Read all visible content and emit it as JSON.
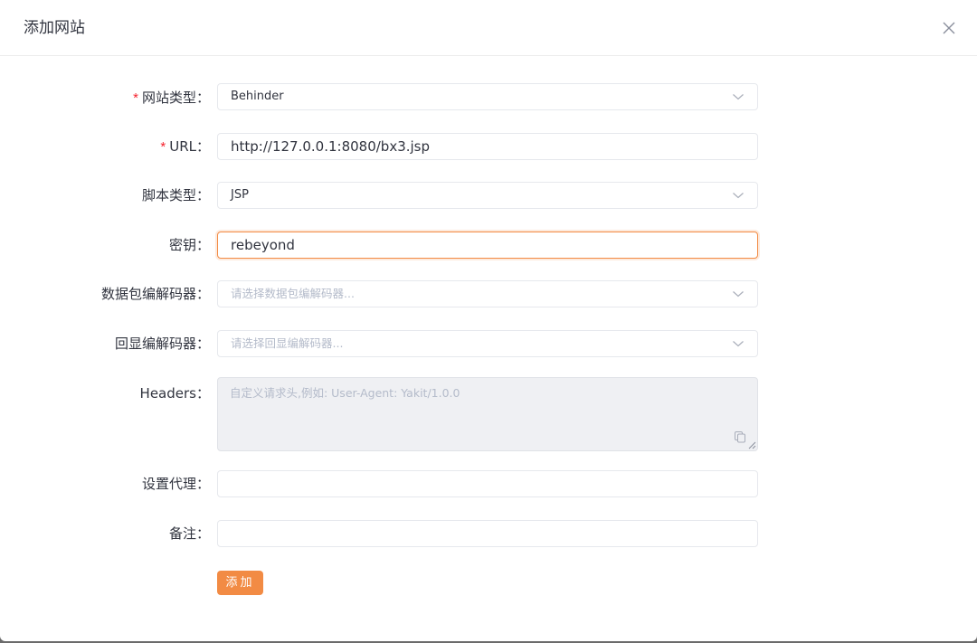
{
  "dialog": {
    "title": "添加网站",
    "close_icon": "close-icon"
  },
  "form": {
    "site_type": {
      "label": "网站类型",
      "required": "*",
      "value": "Behinder"
    },
    "url": {
      "label": "URL",
      "required": "*",
      "value": "http://127.0.0.1:8080/bx3.jsp"
    },
    "script_type": {
      "label": "脚本类型",
      "value": "JSP"
    },
    "secret": {
      "label": "密钥",
      "value": "rebeyond"
    },
    "packet_codec": {
      "label": "数据包编解码器",
      "placeholder": "请选择数据包编解码器..."
    },
    "echo_codec": {
      "label": "回显编解码器",
      "placeholder": "请选择回显编解码器..."
    },
    "headers": {
      "label": "Headers",
      "placeholder": "自定义请求头,例如: User-Agent: Yakit/1.0.0"
    },
    "proxy": {
      "label": "设置代理",
      "value": ""
    },
    "remark": {
      "label": "备注",
      "value": ""
    },
    "colon": "：",
    "submit_label": "添加"
  },
  "colors": {
    "accent": "#f28b44",
    "required": "#f5222d",
    "text": "#31343f",
    "placeholder": "#b4bbca"
  }
}
